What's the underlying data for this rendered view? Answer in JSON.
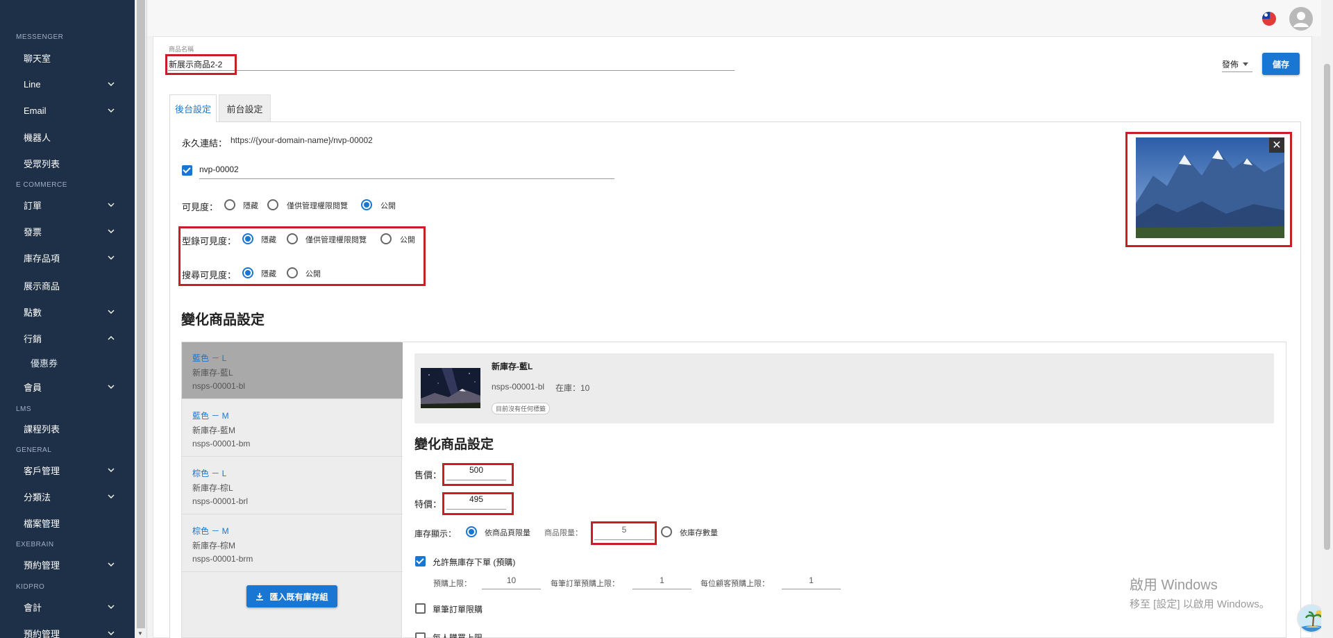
{
  "sidebar": {
    "sections": [
      {
        "title": "MESSENGER"
      },
      {
        "title": "E COMMERCE"
      },
      {
        "title": "LMS"
      },
      {
        "title": "GENERAL"
      },
      {
        "title": "EXEBRAIN"
      },
      {
        "title": "KIDPRO"
      }
    ],
    "items": [
      {
        "label": "聊天室"
      },
      {
        "label": "Line"
      },
      {
        "label": "Email"
      },
      {
        "label": "機器人"
      },
      {
        "label": "受眾列表"
      },
      {
        "label": "訂單"
      },
      {
        "label": "發票"
      },
      {
        "label": "庫存品項"
      },
      {
        "label": "展示商品"
      },
      {
        "label": "點數"
      },
      {
        "label": "行銷"
      },
      {
        "label": "優惠券"
      },
      {
        "label": "會員"
      },
      {
        "label": "課程列表"
      },
      {
        "label": "客戶管理"
      },
      {
        "label": "分類法"
      },
      {
        "label": "檔案管理"
      },
      {
        "label": "預約管理"
      },
      {
        "label": "會計"
      },
      {
        "label": "預約管理"
      }
    ]
  },
  "header": {
    "name_label": "商品名稱",
    "name_value": "新展示商品2-2",
    "publish_label": "發佈",
    "save_label": "儲存"
  },
  "tabs": [
    {
      "label": "後台設定",
      "active": true
    },
    {
      "label": "前台設定",
      "active": false
    }
  ],
  "backend": {
    "permalink_label": "永久連結：",
    "permalink_value": "https://{your-domain-name}/nvp-00002",
    "slug_value": "nvp-00002",
    "visibility_label": "可見度：",
    "visibility_options": [
      "隱藏",
      "僅供管理權限閱覽",
      "公開"
    ],
    "catalog_visibility_label": "型錄可見度：",
    "catalog_options": [
      "隱藏",
      "僅供管理權限閱覽",
      "公開"
    ],
    "search_visibility_label": "搜尋可見度：",
    "search_options": [
      "隱藏",
      "公開"
    ]
  },
  "variations": {
    "section_title": "變化商品設定",
    "list": [
      {
        "title": "藍色 － L",
        "stock_name": "新庫存-藍L",
        "sku": "nsps-00001-bl"
      },
      {
        "title": "藍色 － M",
        "stock_name": "新庫存-藍M",
        "sku": "nsps-00001-bm"
      },
      {
        "title": "棕色 － L",
        "stock_name": "新庫存-棕L",
        "sku": "nsps-00001-brl"
      },
      {
        "title": "棕色 － M",
        "stock_name": "新庫存-棕M",
        "sku": "nsps-00001-brm"
      }
    ],
    "import_button": "匯入既有庫存組",
    "detail": {
      "product_name": "新庫存-藍L",
      "sku": "nsps-00001-bl",
      "stock_text": "在庫：10",
      "tag_chip": "目前沒有任何標籤",
      "settings_title": "變化商品設定",
      "price_label": "售價：",
      "price_value": "500",
      "special_label": "特價：",
      "special_value": "495",
      "stock_display_label": "庫存顯示：",
      "stock_option_product": "依商品頁限量",
      "product_limit_label": "商品限量：",
      "product_limit_value": "5",
      "stock_option_inventory": "依庫存數量",
      "allow_preorder_label": "允許無庫存下單 (預購)",
      "preorder_limit_label": "預購上限：",
      "preorder_limit_value": "10",
      "per_order_limit_label": "每筆訂單預購上限：",
      "per_order_limit_value": "1",
      "per_customer_limit_label": "每位顧客預購上限：",
      "per_customer_limit_value": "1",
      "single_order_label": "單筆訂單限購",
      "per_person_label": "每人購買上限"
    }
  },
  "watermark": {
    "line1": "啟用 Windows",
    "line2": "移至 [設定] 以啟用 Windows。"
  },
  "colors": {
    "accent": "#1976d2",
    "sidebar_bg": "#1e3047",
    "highlight_border": "#c71f25"
  }
}
